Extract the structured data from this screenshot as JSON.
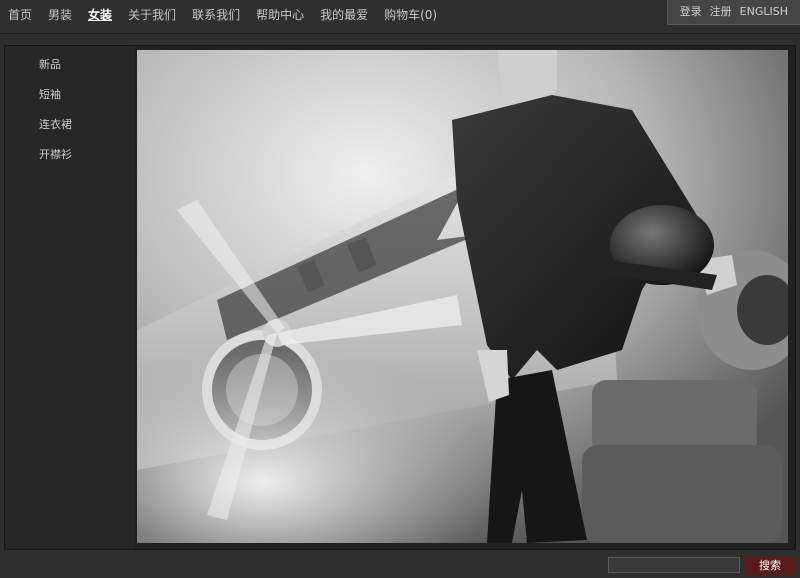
{
  "nav": {
    "items": [
      "首页",
      "男装",
      "女装",
      "关于我们",
      "联系我们",
      "帮助中心",
      "我的最爱",
      "购物车(0)"
    ],
    "active_index": 2
  },
  "user_bar": {
    "login": "登录",
    "register": "注册",
    "language": "ENGLISH"
  },
  "sidebar": {
    "items": [
      "新品",
      "短袖",
      "连衣裙",
      "开襟衫"
    ]
  },
  "search": {
    "value": "",
    "button_label": "搜索"
  },
  "colors": {
    "background": "#2e2e2e",
    "sidebar": "#262626",
    "search_button": "#5a1a1a"
  }
}
